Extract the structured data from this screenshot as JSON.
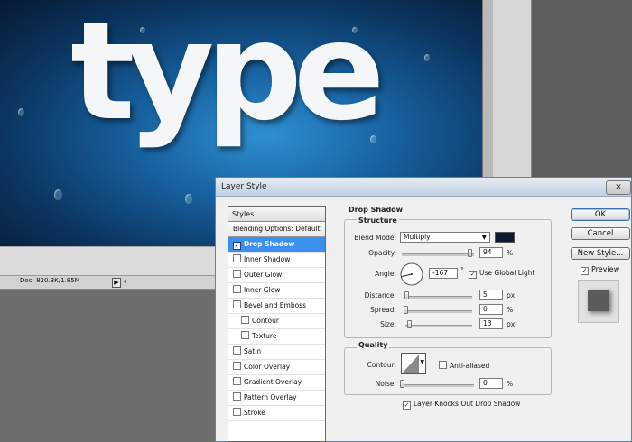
{
  "canvas": {
    "text": "type"
  },
  "statusbar": {
    "doc": "Doc: 820.3K/1.85M",
    "arrow": "▶",
    "scroll_left": "◂"
  },
  "dialog": {
    "title": "Layer Style",
    "close": "✕",
    "styles_header": "Styles",
    "styles": [
      {
        "label": "Blending Options: Default",
        "checkbox": false,
        "checked": false,
        "selected": false,
        "indent": false
      },
      {
        "label": "Drop Shadow",
        "checkbox": true,
        "checked": true,
        "selected": true,
        "indent": false
      },
      {
        "label": "Inner Shadow",
        "checkbox": true,
        "checked": false,
        "selected": false,
        "indent": false
      },
      {
        "label": "Outer Glow",
        "checkbox": true,
        "checked": false,
        "selected": false,
        "indent": false
      },
      {
        "label": "Inner Glow",
        "checkbox": true,
        "checked": false,
        "selected": false,
        "indent": false
      },
      {
        "label": "Bevel and Emboss",
        "checkbox": true,
        "checked": false,
        "selected": false,
        "indent": false
      },
      {
        "label": "Contour",
        "checkbox": true,
        "checked": false,
        "selected": false,
        "indent": true
      },
      {
        "label": "Texture",
        "checkbox": true,
        "checked": false,
        "selected": false,
        "indent": true
      },
      {
        "label": "Satin",
        "checkbox": true,
        "checked": false,
        "selected": false,
        "indent": false
      },
      {
        "label": "Color Overlay",
        "checkbox": true,
        "checked": false,
        "selected": false,
        "indent": false
      },
      {
        "label": "Gradient Overlay",
        "checkbox": true,
        "checked": false,
        "selected": false,
        "indent": false
      },
      {
        "label": "Pattern Overlay",
        "checkbox": true,
        "checked": false,
        "selected": false,
        "indent": false
      },
      {
        "label": "Stroke",
        "checkbox": true,
        "checked": false,
        "selected": false,
        "indent": false
      }
    ],
    "section_title": "Drop Shadow",
    "structure": {
      "title": "Structure",
      "blend_mode_label": "Blend Mode:",
      "blend_mode_value": "Multiply",
      "shadow_color": "#0a1a33",
      "opacity_label": "Opacity:",
      "opacity_value": "94",
      "opacity_fraction": 0.94,
      "angle_label": "Angle:",
      "angle_value": "-167",
      "angle_unit": "°",
      "global_light_label": "Use Global Light",
      "global_light_checked": true,
      "distance_label": "Distance:",
      "distance_value": "5",
      "distance_fraction": 0.02,
      "spread_label": "Spread:",
      "spread_value": "0",
      "spread_fraction": 0.0,
      "size_label": "Size:",
      "size_value": "13",
      "size_fraction": 0.05,
      "percent": "%",
      "px": "px"
    },
    "quality": {
      "title": "Quality",
      "contour_label": "Contour:",
      "anti_aliased_label": "Anti-aliased",
      "anti_aliased_checked": false,
      "noise_label": "Noise:",
      "noise_value": "0",
      "noise_fraction": 0.0,
      "knockout_label": "Layer Knocks Out Drop Shadow",
      "knockout_checked": true
    },
    "buttons": {
      "ok": "OK",
      "cancel": "Cancel",
      "new_style": "New Style...",
      "preview_label": "Preview",
      "preview_checked": true
    }
  }
}
